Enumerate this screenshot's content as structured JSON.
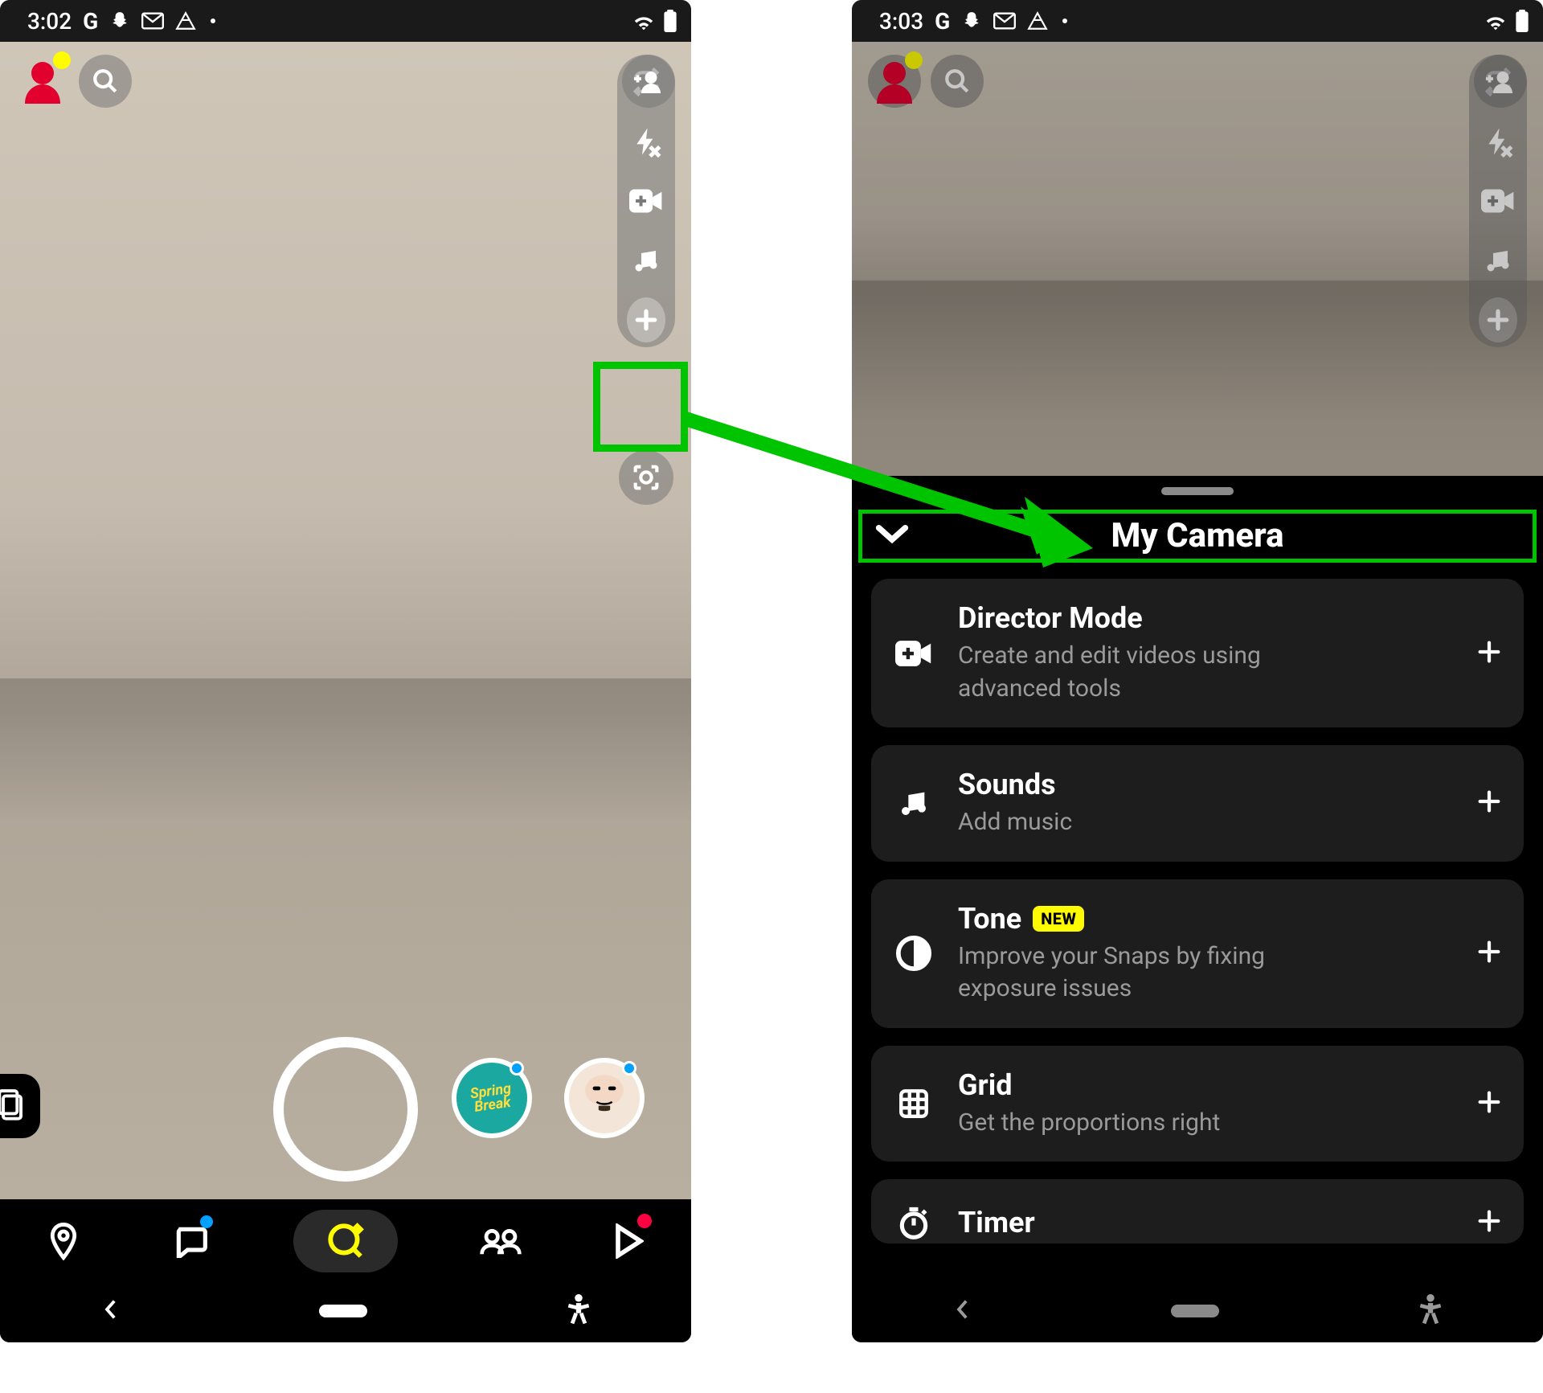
{
  "left": {
    "status_time": "3:02"
  },
  "right": {
    "status_time": "3:03"
  },
  "sheet": {
    "title": "My Camera",
    "items": [
      {
        "title": "Director Mode",
        "sub": "Create and edit videos using advanced tools",
        "badge": ""
      },
      {
        "title": "Sounds",
        "sub": "Add music",
        "badge": ""
      },
      {
        "title": "Tone",
        "sub": "Improve your Snaps by fixing exposure issues",
        "badge": "NEW"
      },
      {
        "title": "Grid",
        "sub": "Get the proportions right",
        "badge": ""
      },
      {
        "title": "Timer",
        "sub": "",
        "badge": ""
      }
    ]
  },
  "lens_labels": {
    "spring_break_1": "Spring",
    "spring_break_2": "Break"
  }
}
